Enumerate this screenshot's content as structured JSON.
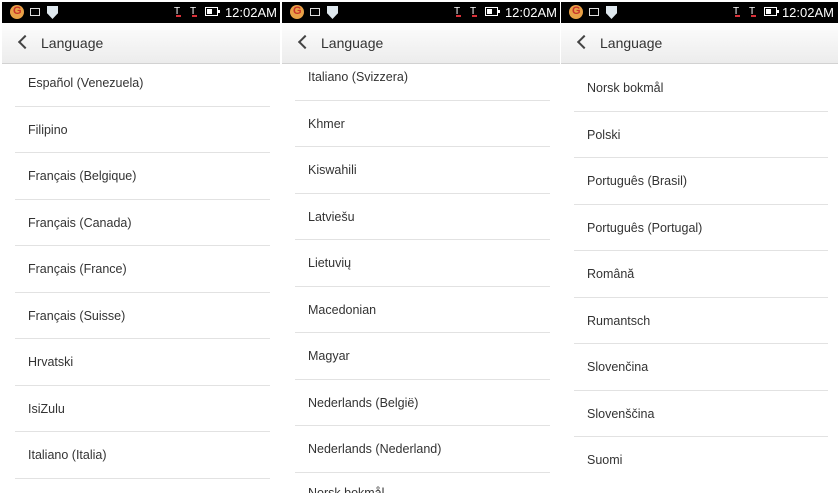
{
  "status_bar": {
    "time": "12:02AM"
  },
  "header": {
    "title": "Language"
  },
  "panels": [
    {
      "items": [
        "Español (Venezuela)",
        "Filipino",
        "Français (Belgique)",
        "Français (Canada)",
        "Français (France)",
        "Français (Suisse)",
        "Hrvatski",
        "IsiZulu",
        "Italiano (Italia)"
      ]
    },
    {
      "items": [
        "Italiano (Svizzera)",
        "Khmer",
        "Kiswahili",
        "Latviešu",
        "Lietuvių",
        "Macedonian",
        "Magyar",
        "Nederlands (België)",
        "Nederlands (Nederland)",
        "Norsk bokmål"
      ]
    },
    {
      "items": [
        "Norsk bokmål",
        "Polski",
        "Português (Brasil)",
        "Português (Portugal)",
        "Română",
        "Rumantsch",
        "Slovenčina",
        "Slovenščina",
        "Suomi"
      ]
    }
  ]
}
